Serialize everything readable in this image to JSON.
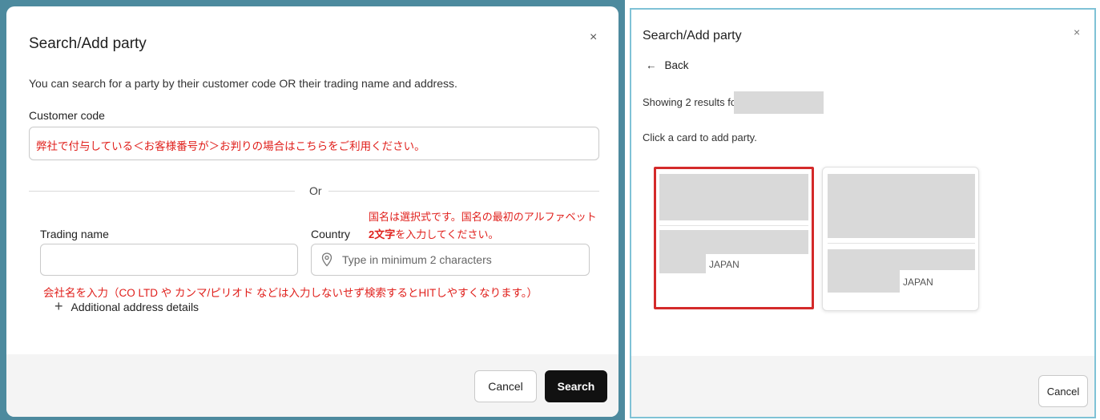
{
  "left_dialog": {
    "title": "Search/Add party",
    "close_glyph": "×",
    "description": "You can search for a party by their customer code OR their trading name and address.",
    "customer_code_label": "Customer code",
    "customer_code_note": "弊社で付与している＜お客様番号が＞お判りの場合はこちらをご利用ください。",
    "or_text": "Or",
    "trading_name_label": "Trading name",
    "country_label": "Country",
    "country_placeholder": "Type in minimum 2 characters",
    "country_note_line1": "国名は選択式です。国名の最初のアルファベット",
    "country_note_line2_bold": "2文字",
    "country_note_line2_rest": "を入力してください。",
    "trading_note": "会社名を入力（CO LTD や カンマ/ピリオド などは入力しないせず検索するとHITしやすくなります。）",
    "additional_plus": "+",
    "additional_label": "Additional address details",
    "cancel_label": "Cancel",
    "search_label": "Search"
  },
  "right_dialog": {
    "title": "Search/Add party",
    "close_glyph": "×",
    "back_arrow": "←",
    "back_label": "Back",
    "showing_text": "Showing 2 results for",
    "click_card_text": "Click a card to add party.",
    "cards": [
      {
        "country": "JAPAN",
        "selected": true
      },
      {
        "country": "JAPAN",
        "selected": false
      }
    ],
    "cancel_label": "Cancel"
  },
  "colors": {
    "annotation_red": "#e0201c",
    "selected_card_border": "#d42a2a",
    "left_frame": "#4d8a9e",
    "right_border": "#7fc2d6",
    "search_button": "#111111"
  },
  "icons": [
    "close-icon",
    "location-pin-icon",
    "plus-icon",
    "back-arrow-icon"
  ]
}
